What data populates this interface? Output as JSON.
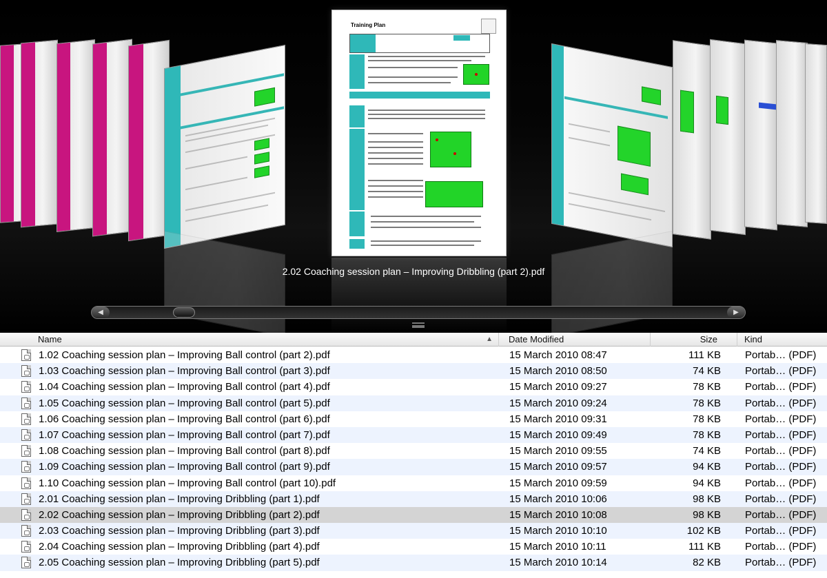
{
  "coverflow": {
    "current_title": "2.02 Coaching session plan – Improving Dribbling (part 2).pdf",
    "preview_heading": "Training Plan",
    "scroll_left_icon": "left-arrow-icon",
    "scroll_right_icon": "right-arrow-icon"
  },
  "list": {
    "headers": {
      "name": "Name",
      "date": "Date Modified",
      "size": "Size",
      "kind": "Kind"
    },
    "sort_indicator": "▲",
    "rows": [
      {
        "name": "1.02 Coaching session plan – Improving Ball control (part 2).pdf",
        "date": "15 March 2010 08:47",
        "size": "111 KB",
        "kind": "Portab… (PDF)"
      },
      {
        "name": "1.03 Coaching session plan – Improving Ball control (part 3).pdf",
        "date": "15 March 2010 08:50",
        "size": "74 KB",
        "kind": "Portab… (PDF)"
      },
      {
        "name": "1.04 Coaching session plan – Improving Ball control (part 4).pdf",
        "date": "15 March 2010 09:27",
        "size": "78 KB",
        "kind": "Portab… (PDF)"
      },
      {
        "name": "1.05 Coaching session plan – Improving Ball control (part 5).pdf",
        "date": "15 March 2010 09:24",
        "size": "78 KB",
        "kind": "Portab… (PDF)"
      },
      {
        "name": "1.06 Coaching session plan – Improving Ball control (part 6).pdf",
        "date": "15 March 2010 09:31",
        "size": "78 KB",
        "kind": "Portab… (PDF)"
      },
      {
        "name": "1.07 Coaching session plan – Improving Ball control (part 7).pdf",
        "date": "15 March 2010 09:49",
        "size": "78 KB",
        "kind": "Portab… (PDF)"
      },
      {
        "name": "1.08 Coaching session plan – Improving Ball control (part 8).pdf",
        "date": "15 March 2010 09:55",
        "size": "74 KB",
        "kind": "Portab… (PDF)"
      },
      {
        "name": "1.09 Coaching session plan – Improving Ball control (part 9).pdf",
        "date": "15 March 2010 09:57",
        "size": "94 KB",
        "kind": "Portab… (PDF)"
      },
      {
        "name": "1.10 Coaching session plan – Improving Ball control (part 10).pdf",
        "date": "15 March 2010 09:59",
        "size": "94 KB",
        "kind": "Portab… (PDF)"
      },
      {
        "name": "2.01 Coaching session plan – Improving Dribbling (part 1).pdf",
        "date": "15 March 2010 10:06",
        "size": "98 KB",
        "kind": "Portab… (PDF)"
      },
      {
        "name": "2.02 Coaching session plan – Improving Dribbling (part 2).pdf",
        "date": "15 March 2010 10:08",
        "size": "98 KB",
        "kind": "Portab… (PDF)",
        "selected": true
      },
      {
        "name": "2.03 Coaching session plan – Improving Dribbling (part 3).pdf",
        "date": "15 March 2010 10:10",
        "size": "102 KB",
        "kind": "Portab… (PDF)"
      },
      {
        "name": "2.04 Coaching session plan – Improving Dribbling (part 4).pdf",
        "date": "15 March 2010 10:11",
        "size": "111 KB",
        "kind": "Portab… (PDF)"
      },
      {
        "name": "2.05 Coaching session plan – Improving Dribbling (part 5).pdf",
        "date": "15 March 2010 10:14",
        "size": "82 KB",
        "kind": "Portab… (PDF)"
      }
    ]
  },
  "colors": {
    "accent_teal": "#2fb8b8",
    "accent_magenta": "#c8157f",
    "pitch_green": "#22d428",
    "row_alt": "#edf3fe",
    "row_selected": "#d4d4d4"
  }
}
